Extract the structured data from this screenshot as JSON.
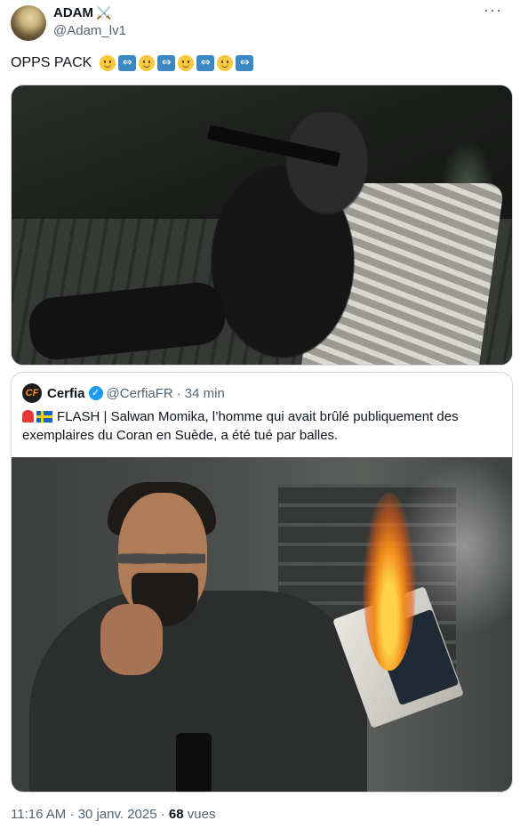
{
  "author": {
    "display_name": "ADAM",
    "name_emoji": "⚔️",
    "handle": "@Adam_lv1"
  },
  "more_icon": "···",
  "tweet": {
    "text": "OPPS PACK",
    "emoji_sequence": [
      "slightly-smiling-face",
      "left-right-arrow",
      "slightly-smiling-face",
      "left-right-arrow",
      "slightly-smiling-face",
      "left-right-arrow",
      "slightly-smiling-face",
      "left-right-arrow"
    ]
  },
  "quoted_tweet": {
    "logo_text": "CF",
    "display_name": "Cerfia",
    "handle": "@CerfiaFR",
    "separator": "·",
    "time": "34 min",
    "flags": [
      "police-car-light",
      "flag-sweden"
    ],
    "text": "FLASH | Salwan Momika, l’homme qui avait brûlé publiquement des exemplaires du Coran en Suède, a été tué par balles."
  },
  "meta": {
    "time": "11:16 AM",
    "separator": "·",
    "date": "30 janv. 2025",
    "views_count": "68",
    "views_label": "vues"
  },
  "colors": {
    "text_primary": "#0f1419",
    "text_secondary": "#536471",
    "verified_blue": "#1d9bf0",
    "border": "#cfd9de"
  }
}
